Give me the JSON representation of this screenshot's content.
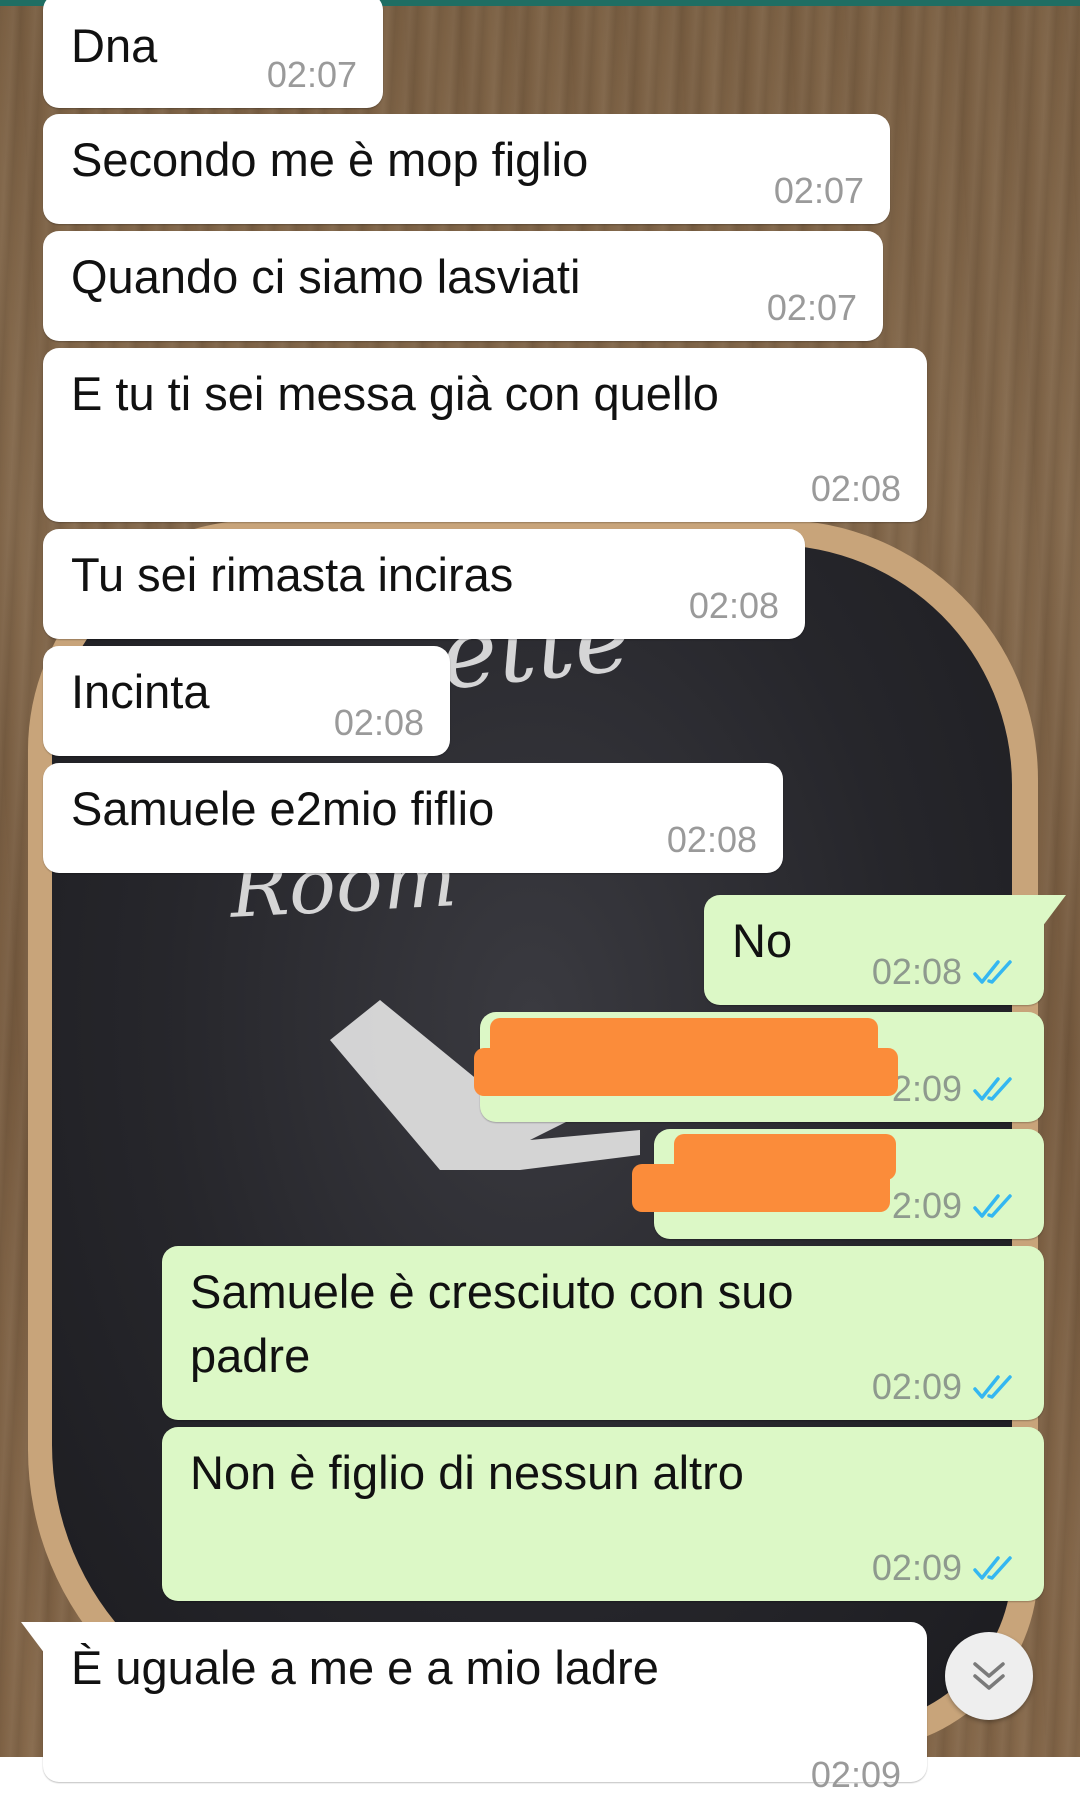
{
  "chat": {
    "messages": [
      {
        "text": "Dna",
        "time": "02:07"
      },
      {
        "text": "Secondo me è mop figlio",
        "time": "02:07"
      },
      {
        "text": "Quando ci siamo lasviati",
        "time": "02:07"
      },
      {
        "text": "E tu ti sei messa già con quello",
        "time": "02:08"
      },
      {
        "text": "Tu sei rimasta inciras",
        "time": "02:08"
      },
      {
        "text": "Incinta",
        "time": "02:08"
      },
      {
        "text": "Samuele e2mio fiflio",
        "time": "02:08"
      },
      {
        "text": "No",
        "time": "02:08"
      },
      {
        "time_visible": "2:09"
      },
      {
        "time_visible": "2:09"
      },
      {
        "text_line1": "Samuele è cresciuto con suo",
        "text_line2": "padre",
        "time": "02:09"
      },
      {
        "text": "Non è figlio di nessun altro",
        "time": "02:09"
      },
      {
        "text": "È uguale a me e a mio ladre",
        "time": "02:09"
      }
    ],
    "read_status_icon": "double-check-icon",
    "scroll_button_icon": "double-chevron-down-icon"
  },
  "wallpaper": {
    "chalk_text_1": "ette",
    "chalk_text_2": "Room"
  },
  "colors": {
    "incoming_bubble": "#ffffff",
    "outgoing_bubble": "#dcf8c6",
    "read_ticks": "#34b7f1",
    "redaction": "#fb8c3a"
  }
}
